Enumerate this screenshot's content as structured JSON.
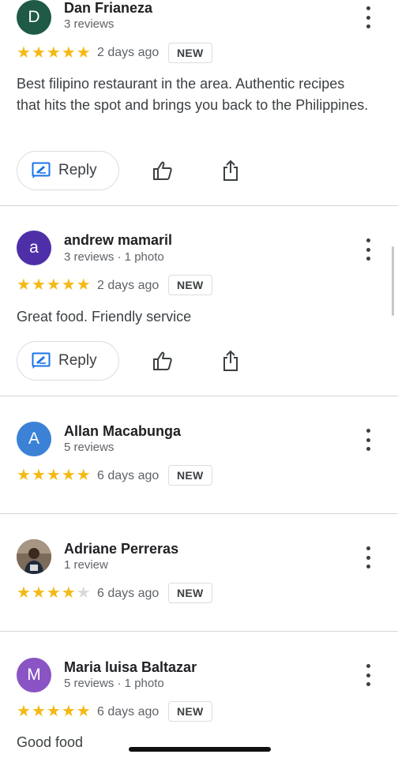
{
  "reviews": [
    {
      "name": "Dan Frianeza",
      "meta": "3 reviews",
      "initial": "D",
      "avatar_color": "#1e5a45",
      "rating": 5,
      "date": "2 days ago",
      "badge": "NEW",
      "text": "Best filipino restaurant in the area. Authentic recipes that hits the spot and brings you back to the Philippines.",
      "reply_label": "Reply"
    },
    {
      "name": "andrew mamaril",
      "meta": "3 reviews · 1 photo",
      "initial": "a",
      "avatar_color": "#4f2fa8",
      "rating": 5,
      "date": "2 days ago",
      "badge": "NEW",
      "text": "Great food. Friendly service",
      "reply_label": "Reply"
    },
    {
      "name": "Allan Macabunga",
      "meta": "5 reviews",
      "initial": "A",
      "avatar_color": "#3b82d6",
      "rating": 5,
      "date": "6 days ago",
      "badge": "NEW"
    },
    {
      "name": "Adriane Perreras",
      "meta": "1 review",
      "initial": "",
      "avatar_color": "#6a5a4d",
      "rating": 4,
      "date": "6 days ago",
      "badge": "NEW"
    },
    {
      "name": "Maria luisa Baltazar",
      "meta": "5 reviews · 1 photo",
      "initial": "M",
      "avatar_color": "#8a54c4",
      "rating": 5,
      "date": "6 days ago",
      "badge": "NEW",
      "text": "Good food"
    }
  ],
  "colors": {
    "star": "#f5b914",
    "star_empty": "#d9d9d9",
    "reply_icon": "#1a73e8"
  },
  "icons": {
    "reply": "reply-icon",
    "like": "thumbs-up-icon",
    "share": "share-icon",
    "more": "more-vert-icon"
  }
}
